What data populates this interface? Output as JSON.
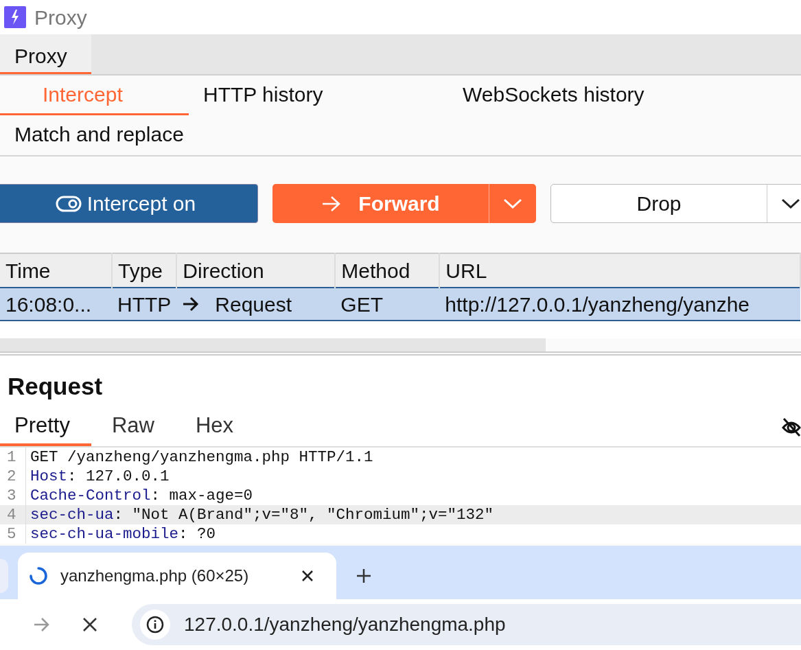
{
  "app": {
    "title": "Proxy"
  },
  "main_tabs": [
    {
      "label": "Proxy",
      "selected": true
    }
  ],
  "proxy_tabs": [
    {
      "label": "Intercept",
      "selected": true
    },
    {
      "label": "HTTP history",
      "selected": false
    },
    {
      "label": "WebSockets history",
      "selected": false
    },
    {
      "label": "Match and replace",
      "selected": false
    }
  ],
  "toolbar": {
    "intercept": {
      "label": "Intercept on",
      "on": true
    },
    "forward": {
      "label": "Forward"
    },
    "drop": {
      "label": "Drop"
    }
  },
  "table": {
    "columns": [
      "Time",
      "Type",
      "Direction",
      "Method",
      "URL"
    ],
    "rows": [
      {
        "selected": true,
        "cells": [
          "16:08:0...",
          "HTTP",
          "Request",
          "GET",
          "http://127.0.0.1/yanzheng/yanzhe"
        ]
      }
    ]
  },
  "request": {
    "title": "Request",
    "tabs": [
      {
        "label": "Pretty",
        "selected": true
      },
      {
        "label": "Raw",
        "selected": false
      },
      {
        "label": "Hex",
        "selected": false
      }
    ],
    "lines": [
      {
        "number": "1",
        "kind": "start",
        "text": "GET /yanzheng/yanzhengma.php HTTP/1.1",
        "highlighted": false
      },
      {
        "number": "2",
        "kind": "header",
        "name": "Host",
        "value": ": 127.0.0.1",
        "highlighted": false
      },
      {
        "number": "3",
        "kind": "header",
        "name": "Cache-Control",
        "value": ": max-age=0",
        "highlighted": false
      },
      {
        "number": "4",
        "kind": "header",
        "name": "sec-ch-ua",
        "value": ": \"Not A(Brand\";v=\"8\", \"Chromium\";v=\"132\"",
        "highlighted": true
      },
      {
        "number": "5",
        "kind": "header",
        "name": "sec-ch-ua-mobile",
        "value": ": ?0",
        "highlighted": false
      }
    ]
  },
  "browser": {
    "tabs": [
      {
        "title": "yanzhengma.php (60×25)",
        "loading": true,
        "selected": true
      }
    ],
    "address": "127.0.0.1/yanzheng/yanzhengma.php"
  }
}
